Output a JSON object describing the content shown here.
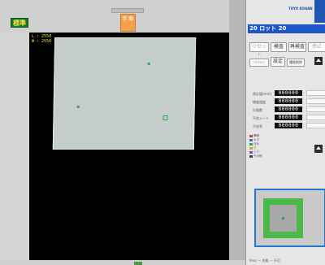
{
  "header": {
    "badge_label": "標準",
    "mode_tile_label": "手\n動",
    "brand_text": "TOYO KOHAN"
  },
  "viewer": {
    "readout_line1": "L : 2550",
    "readout_line2": "W : 2550"
  },
  "panel": {
    "lot_label": "20 ロット 20",
    "buttons": {
      "reset": "リセット",
      "inspect": "検査",
      "reinspect": "再検査",
      "stop": "停止",
      "history": "History",
      "settings": "設定",
      "clear_history": "履歴削除"
    },
    "rows": [
      {
        "label": "原反幅(mm)",
        "value": "000000"
      },
      {
        "label": "検査速度",
        "value": "000000"
      },
      {
        "label": "欠陥数",
        "value": "000000"
      },
      {
        "label": "不良シート",
        "value": "000000"
      },
      {
        "label": "不良率",
        "value": "000000"
      }
    ],
    "legend": [
      {
        "name": "異物",
        "color": "#d93a3a"
      },
      {
        "name": "キズ",
        "color": "#2f7ad6"
      },
      {
        "name": "汚れ",
        "color": "#2fa84b"
      },
      {
        "name": "穴",
        "color": "#e0a020"
      },
      {
        "name": "シワ",
        "color": "#9a40c0"
      },
      {
        "name": "その他",
        "color": "#444444"
      }
    ],
    "footer": "Pass — 合格 — 不可"
  },
  "colors": {
    "lot_bg": "#1f56c6",
    "badge_bg": "#0f7a2e",
    "thumb_border": "#1f78d1",
    "accent_green": "#4db84a"
  }
}
